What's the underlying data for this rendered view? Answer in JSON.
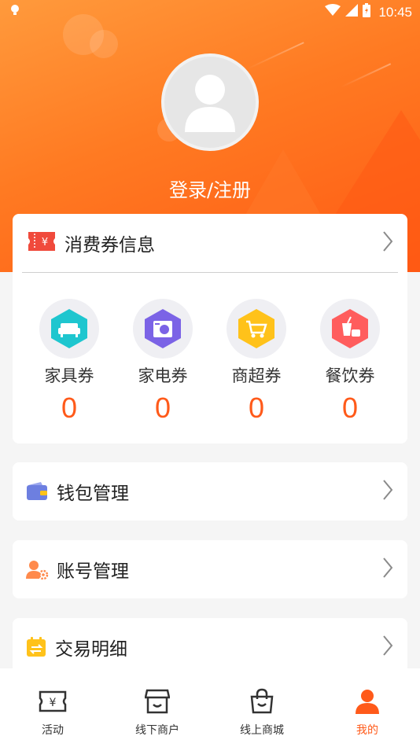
{
  "status_bar": {
    "time": "10:45"
  },
  "profile": {
    "login_label": "登录/注册"
  },
  "coupon_section": {
    "title": "消费券信息",
    "items": [
      {
        "label": "家具券",
        "count": "0",
        "icon": "sofa-icon",
        "color": "#1ec6cf"
      },
      {
        "label": "家电券",
        "count": "0",
        "icon": "appliance-icon",
        "color": "#7b63e6"
      },
      {
        "label": "商超券",
        "count": "0",
        "icon": "cart-icon",
        "color": "#ffc21a"
      },
      {
        "label": "餐饮券",
        "count": "0",
        "icon": "drink-icon",
        "color": "#ff5d5d"
      }
    ]
  },
  "menu": [
    {
      "label": "钱包管理",
      "icon": "wallet-icon"
    },
    {
      "label": "账号管理",
      "icon": "account-settings-icon"
    },
    {
      "label": "交易明细",
      "icon": "transaction-icon"
    }
  ],
  "tabbar": {
    "tabs": [
      {
        "label": "活动",
        "icon": "ticket-icon"
      },
      {
        "label": "线下商户",
        "icon": "store-icon"
      },
      {
        "label": "线上商城",
        "icon": "shopping-bag-icon"
      },
      {
        "label": "我的",
        "icon": "profile-icon",
        "active": true
      }
    ]
  },
  "colors": {
    "accent": "#ff5a1a",
    "header_gradient_start": "#ff9a3c",
    "header_gradient_end": "#ff5a14"
  }
}
